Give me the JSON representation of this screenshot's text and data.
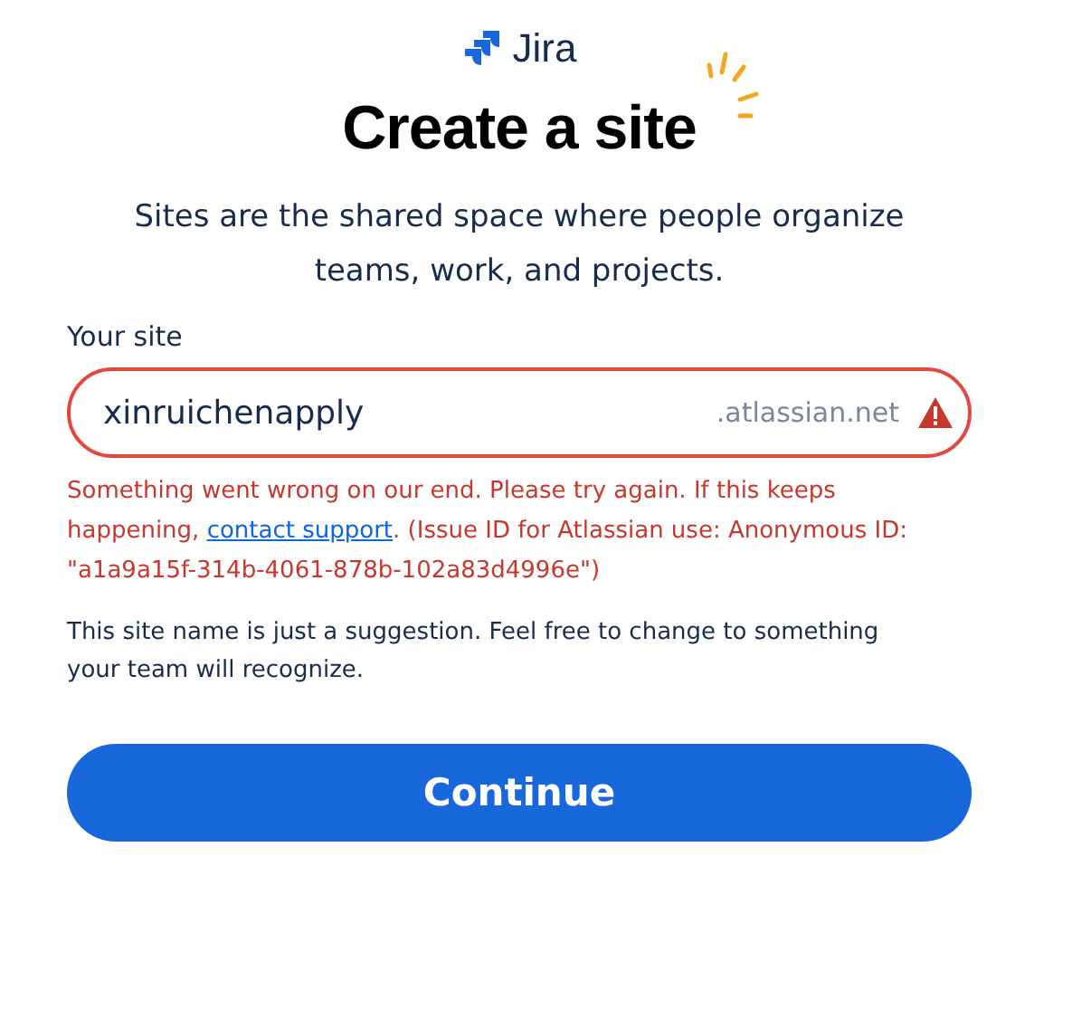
{
  "brand": {
    "name": "Jira"
  },
  "heading": "Create a site",
  "intro": "Sites are the shared space where people organize teams, work, and projects.",
  "site_field": {
    "label": "Your site",
    "value": "xinruichenapply",
    "suffix": ".atlassian.net",
    "error": true
  },
  "error_message": {
    "before": "Something went wrong on our end. Please try again. If this keeps happening, ",
    "link": "contact support",
    "after": ". (Issue ID for Atlassian use: Anonymous ID: \"a1a9a15f-314b-4061-878b-102a83d4996e\")"
  },
  "hint": "This site name is just a suggestion. Feel free to change to something your team will recognize.",
  "buttons": [
    {
      "label": "Continue",
      "kind": "primary"
    }
  ]
}
